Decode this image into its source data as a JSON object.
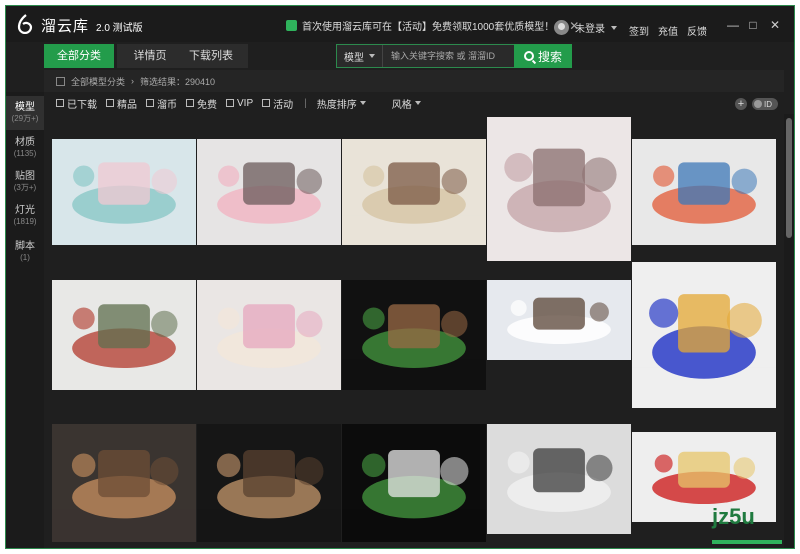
{
  "app": {
    "name": "溜云库",
    "version": "2.0 测试版"
  },
  "notice": {
    "text": "首次使用溜云库可在【活动】免费领取1000套优质模型！",
    "close_icon": "close-icon"
  },
  "user": {
    "login_label": "未登录",
    "links": [
      "签到",
      "充值",
      "反馈"
    ]
  },
  "window_controls": {
    "minimize": "—",
    "maximize": "□",
    "close": "✕"
  },
  "tabs": [
    {
      "label": "全部分类",
      "active": true
    },
    {
      "label": "详情页",
      "active": false
    },
    {
      "label": "下载列表",
      "active": false
    }
  ],
  "search": {
    "type_label": "模型",
    "placeholder": "输入关键字搜索 或 溜溜ID",
    "button_label": "搜索"
  },
  "breadcrumb": {
    "root": "全部模型分类",
    "separator": "›",
    "result": "筛选结果：290410"
  },
  "sidebar": {
    "items": [
      {
        "name": "模型",
        "count": "(29万+)",
        "active": true
      },
      {
        "name": "材质",
        "count": "(1135)",
        "active": false
      },
      {
        "name": "贴图",
        "count": "(3万+)",
        "active": false
      },
      {
        "name": "灯光",
        "count": "(1819)",
        "active": false
      },
      {
        "name": "脚本",
        "count": "(1)",
        "active": false
      }
    ]
  },
  "filters": {
    "checkboxes": [
      "已下载",
      "精品",
      "溜币",
      "免费",
      "VIP",
      "活动"
    ],
    "separator": "|",
    "sort_label": "热度排序",
    "style_label": "风格"
  },
  "toggles": {
    "add_icon": "plus-icon",
    "id_label": "ID"
  },
  "models": [
    {
      "theme": "party-backdrop-blue",
      "colors": [
        "#d8e6ea",
        "#8fc9c9",
        "#f0c8d2"
      ]
    },
    {
      "theme": "flower-bouquet-stands",
      "colors": [
        "#e6e4e4",
        "#f0b7c4",
        "#6b5b5b"
      ]
    },
    {
      "theme": "bunk-bed-kids-room",
      "colors": [
        "#e9e3d8",
        "#d7c7a8",
        "#7b5a45"
      ]
    },
    {
      "theme": "bedroom-chandelier",
      "colors": [
        "#ece6e6",
        "#c9aaae",
        "#8a6e6e"
      ]
    },
    {
      "theme": "hot-air-balloon-windmill",
      "colors": [
        "#e8e8e8",
        "#e36a4a",
        "#3d78b8"
      ]
    },
    {
      "theme": "japanese-garden-maple",
      "colors": [
        "#e8e8e6",
        "#b84e42",
        "#5f6f4e"
      ]
    },
    {
      "theme": "flower-swan-wall",
      "colors": [
        "#eae6e4",
        "#f2e6da",
        "#e6a7bf"
      ]
    },
    {
      "theme": "bicycle-flower-stage",
      "colors": [
        "#111111",
        "#3e8a3a",
        "#9a6a45"
      ]
    },
    {
      "theme": "reception-desk-white",
      "colors": [
        "#e6e9ee",
        "#ffffff",
        "#5a4436"
      ]
    },
    {
      "theme": "tower-display-sign",
      "colors": [
        "#efefef",
        "#2a3cc8",
        "#e4a834"
      ]
    },
    {
      "theme": "round-lattice-screens",
      "colors": [
        "#3a3430",
        "#b8865a",
        "#6e4e36"
      ]
    },
    {
      "theme": "chinese-round-windows",
      "colors": [
        "#161616",
        "#b08862",
        "#5a4230"
      ]
    },
    {
      "theme": "garden-arch-stage",
      "colors": [
        "#0c0c0c",
        "#3e8a3a",
        "#e8e8e8"
      ]
    },
    {
      "theme": "white-tv-wall",
      "colors": [
        "#dcdcdc",
        "#f0f0f0",
        "#3b3b3b"
      ]
    },
    {
      "theme": "red-culture-wall",
      "colors": [
        "#eeeeee",
        "#cf2b2b",
        "#e7c66a"
      ]
    }
  ],
  "watermark": {
    "text": "jz5u"
  }
}
